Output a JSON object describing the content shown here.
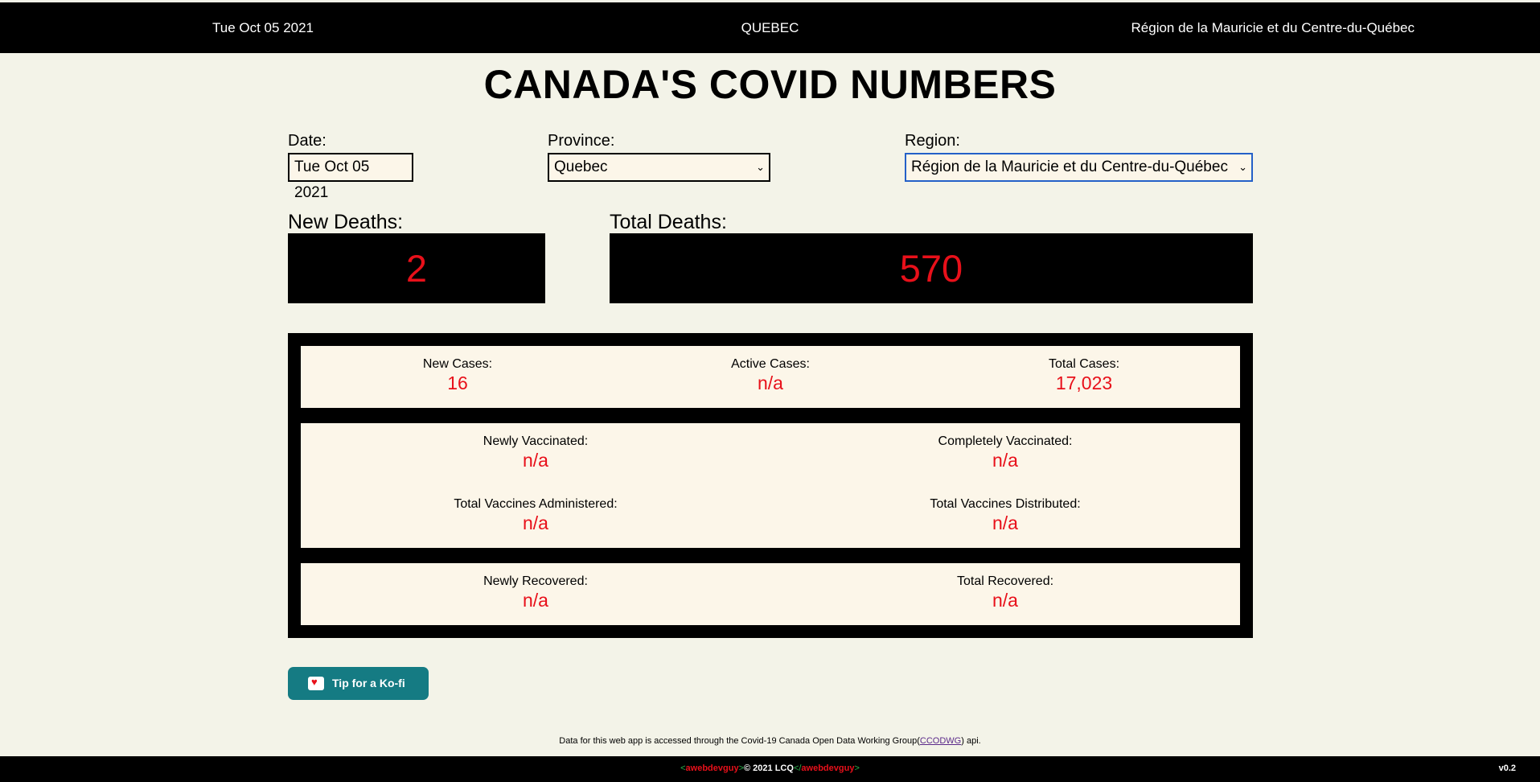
{
  "topbar": {
    "date": "Tue Oct 05 2021",
    "province": "QUEBEC",
    "region": "Région de la Mauricie et du Centre-du-Québec"
  },
  "title": "CANADA'S COVID NUMBERS",
  "filters": {
    "date_label": "Date:",
    "date_value": "Tue Oct 05 2021",
    "province_label": "Province:",
    "province_value": "Quebec",
    "region_label": "Region:",
    "region_value": "Région de la Mauricie et du Centre-du-Québec"
  },
  "deaths": {
    "new_label": "New Deaths:",
    "new_value": "2",
    "total_label": "Total Deaths:",
    "total_value": "570"
  },
  "cases": {
    "new_label": "New Cases:",
    "new_value": "16",
    "active_label": "Active Cases:",
    "active_value": "n/a",
    "total_label": "Total Cases:",
    "total_value": "17,023"
  },
  "vaccines": {
    "newly_label": "Newly Vaccinated:",
    "newly_value": "n/a",
    "complete_label": "Completely Vaccinated:",
    "complete_value": "n/a",
    "administered_label": "Total Vaccines Administered:",
    "administered_value": "n/a",
    "distributed_label": "Total Vaccines Distributed:",
    "distributed_value": "n/a"
  },
  "recovered": {
    "new_label": "Newly Recovered:",
    "new_value": "n/a",
    "total_label": "Total Recovered:",
    "total_value": "n/a"
  },
  "kofi": {
    "label": "Tip for a Ko-fi",
    "icon": "coffee-cup-heart-icon"
  },
  "note": {
    "before": "Data for this web app is accessed through the Covid-19 Canada Open Data Working Group(",
    "link": "CCODWG",
    "after": ") api."
  },
  "footer": {
    "open_lt": "<",
    "name1": "awebdevguy",
    "open_gt": ">",
    "copyright": "© 2021 LCQ",
    "close_lt": "</",
    "name2": "awebdevguy",
    "close_gt": ">",
    "version": "v0.2"
  },
  "colors": {
    "accent_red": "#e8101a",
    "kofi_teal": "#157b83",
    "background": "#f3f3e8",
    "panel": "#fcf6e9"
  }
}
